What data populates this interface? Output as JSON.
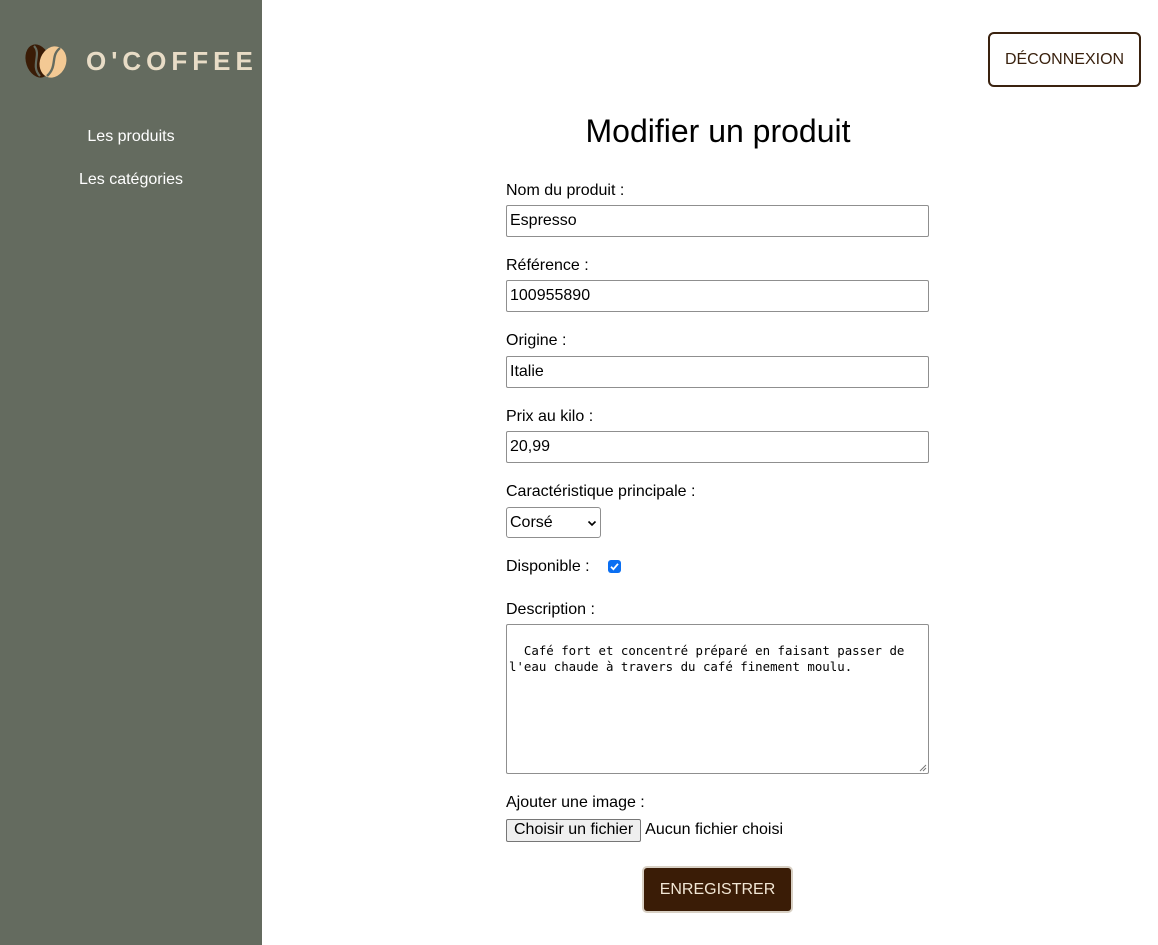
{
  "brand": {
    "name": "O'COFFEE",
    "logo_icon": "coffee-beans-icon",
    "text_color": "#e8dcc6"
  },
  "sidebar": {
    "background": "#646b5f",
    "items": [
      {
        "label": "Les produits"
      },
      {
        "label": "Les catégories"
      }
    ]
  },
  "header": {
    "logout_label": "DÉCONNEXION"
  },
  "form": {
    "title": "Modifier un produit",
    "name": {
      "label": "Nom du produit :",
      "value": "Espresso"
    },
    "reference": {
      "label": "Référence :",
      "value": "100955890"
    },
    "origin": {
      "label": "Origine :",
      "value": "Italie"
    },
    "price": {
      "label": "Prix au kilo :",
      "value": "20,99"
    },
    "characteristic": {
      "label": "Caractéristique principale :",
      "selected": "Corsé"
    },
    "available": {
      "label": "Disponible :",
      "checked": true
    },
    "description": {
      "label": "Description :",
      "value": "Café fort et concentré préparé en faisant passer de l'eau chaude à travers du café finement moulu."
    },
    "image": {
      "label": "Ajouter une image :",
      "button_label": "Choisir un fichier",
      "status": "Aucun fichier choisi"
    },
    "submit_label": "ENREGISTRER",
    "accent": "#3a1c06"
  }
}
